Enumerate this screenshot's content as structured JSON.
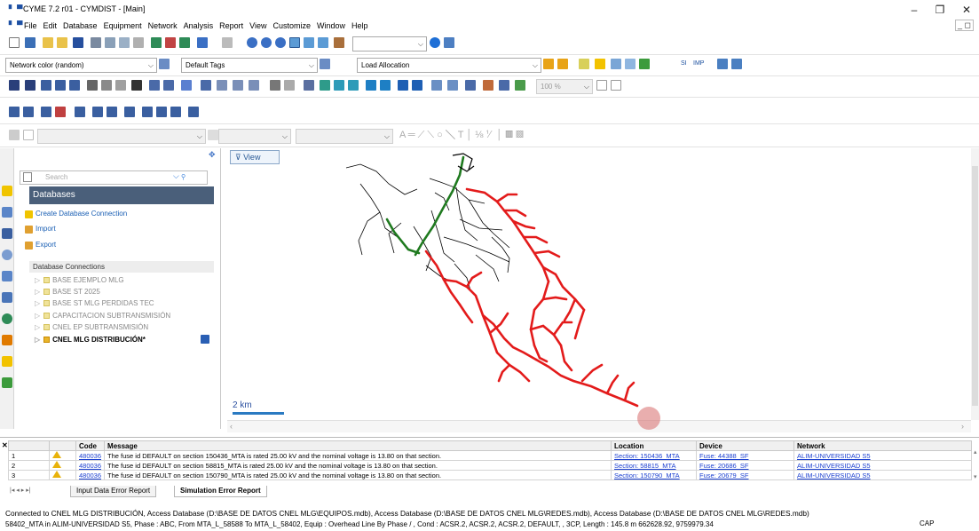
{
  "window": {
    "title": "CYME 7.2 r01 - CYMDIST - [Main]",
    "app_icon": "CYME-icon",
    "minimize": "–",
    "restore": "❐",
    "close": "✕",
    "mdi_controls": "_ ◻"
  },
  "menu": [
    "File",
    "Edit",
    "Database",
    "Equipment",
    "Network",
    "Analysis",
    "Report",
    "View",
    "Customize",
    "Window",
    "Help"
  ],
  "toolbar": {
    "network_color": "Network color (random)",
    "tags": "Default Tags",
    "analysis": "Load Allocation",
    "zoom": "100 %",
    "units_si": "SI",
    "units_imp": "IMP"
  },
  "left_panel": {
    "search_placeholder": "Search",
    "databases_header": "Databases",
    "actions": [
      "Create Database Connection",
      "Import",
      "Export"
    ],
    "connections_header": "Database Connections",
    "connections": [
      "BASE EJEMPLO MLG",
      "BASE ST 2025",
      "BASE ST MLG PERDIDAS TEC",
      "CAPACITACION SUBTRANSMISIÓN",
      "CNEL EP SUBTRANSMISIÓN",
      "CNEL MLG DISTRIBUCIÓN*"
    ]
  },
  "map": {
    "view_button": "View",
    "scale_label": "2 km",
    "colors": {
      "red": "#e31b1b",
      "green": "#1f7a1f",
      "black": "#000000"
    }
  },
  "error_grid": {
    "columns": [
      "Code",
      "Message",
      "Location",
      "Device",
      "Network"
    ],
    "rows": [
      {
        "num": "1",
        "code": "480036",
        "message": "The fuse id DEFAULT on section 150436_MTA is rated 25.00 kV and the nominal voltage is 13.80 on that section.",
        "location": "Section: 150436_MTA",
        "device": "Fuse: 44388_SF",
        "network": "ALIM-UNIVERSIDAD S5"
      },
      {
        "num": "2",
        "code": "480036",
        "message": "The fuse id DEFAULT on section 58815_MTA is rated 25.00 kV and the nominal voltage is 13.80 on that section.",
        "location": "Section: 58815_MTA",
        "device": "Fuse: 20686_SF",
        "network": "ALIM-UNIVERSIDAD S5"
      },
      {
        "num": "3",
        "code": "480036",
        "message": "The fuse id DEFAULT on section 150790_MTA is rated 25.00 kV and the nominal voltage is 13.80 on that section.",
        "location": "Section: 150790_MTA",
        "device": "Fuse: 20679_SF",
        "network": "ALIM-UNIVERSIDAD S5"
      }
    ],
    "tabs": [
      "Input Data Error Report",
      "Simulation Error Report"
    ]
  },
  "status": {
    "line1": "Connected to CNEL MLG DISTRIBUCIÓN, Access Database (D:\\BASE DE DATOS CNEL MLG\\EQUIPOS.mdb), Access Database (D:\\BASE DE DATOS CNEL MLG\\REDES.mdb), Access Database (D:\\BASE DE DATOS CNEL MLG\\REDES.mdb)",
    "line2": "58402_MTA in ALIM-UNIVERSIDAD S5, Phase : ABC, From MTA_L_58588 To MTA_L_58402, Equip : Overhead Line By Phase / , Cond : ACSR.2, ACSR.2, ACSR.2, DEFAULT, , 3CP, Length :  145.8 m   662628.92, 9759979.34",
    "caps": "CAP"
  }
}
